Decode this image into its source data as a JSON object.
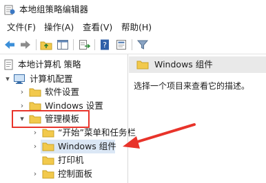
{
  "window": {
    "title": "本地组策略编辑器",
    "icon": "policy-editor-icon"
  },
  "menu": [
    {
      "label": "文件(F)"
    },
    {
      "label": "操作(A)"
    },
    {
      "label": "查看(V)"
    },
    {
      "label": "帮助(H)"
    }
  ],
  "toolbar": {
    "buttons": [
      "back-arrow-icon",
      "forward-arrow-icon",
      "up-folder-icon",
      "show-hide-tree-icon",
      "export-list-icon",
      "help-icon",
      "properties-icon",
      "filter-icon"
    ]
  },
  "tree": {
    "items": [
      {
        "label": "本地计算机 策略",
        "icon": "computer-policy-icon",
        "expander": ""
      },
      {
        "label": "计算机配置",
        "icon": "computer-icon",
        "expander": "▾"
      },
      {
        "label": "软件设置",
        "icon": "folder-icon",
        "expander": "›"
      },
      {
        "label": "Windows 设置",
        "icon": "folder-icon",
        "expander": "›"
      },
      {
        "label": "管理模板",
        "icon": "folder-icon",
        "expander": "▾"
      },
      {
        "label": "“开始”菜单和任务栏",
        "icon": "folder-icon",
        "expander": "›"
      },
      {
        "label": "Windows 组件",
        "icon": "folder-icon",
        "expander": "›"
      },
      {
        "label": "打印机",
        "icon": "folder-icon",
        "expander": ""
      },
      {
        "label": "控制面板",
        "icon": "folder-icon",
        "expander": "›"
      }
    ]
  },
  "right_pane": {
    "header": "Windows 组件",
    "description": "选择一个项目来查看它的描述。"
  },
  "colors": {
    "annotation": "#e8332a",
    "folder": "#f2c94c",
    "selection": "#dbe7f5",
    "header_bg": "#e9e9e9"
  }
}
